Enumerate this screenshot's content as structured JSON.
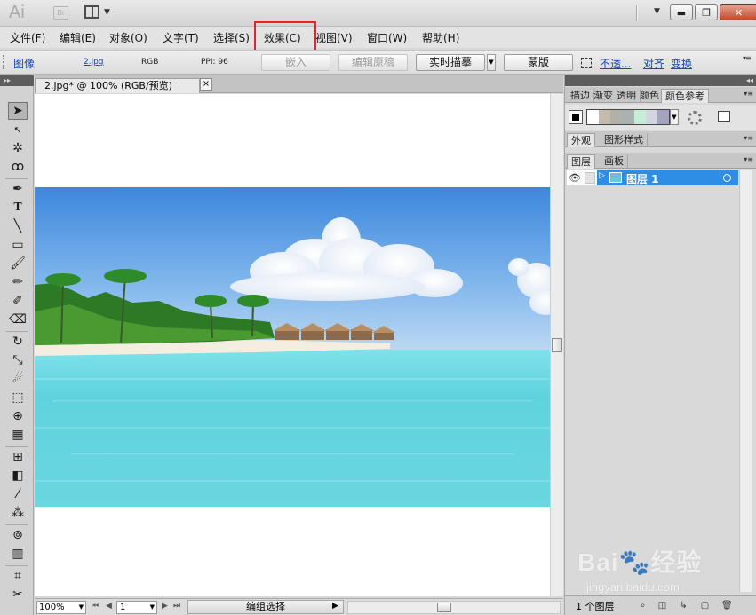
{
  "app": {
    "logo": "Ai",
    "bridge": "Br"
  },
  "menubar": {
    "items": [
      "文件(F)",
      "编辑(E)",
      "对象(O)",
      "文字(T)",
      "选择(S)",
      "效果(C)",
      "视图(V)",
      "窗口(W)",
      "帮助(H)"
    ],
    "highlighted": "效果(C)",
    "highlight_color": "#e0242a"
  },
  "control_bar": {
    "type_label": "图像",
    "filename": "2.jpg",
    "color_mode": "RGB",
    "ppi": "PPI: 96",
    "embed_label": "嵌入",
    "edit_original_label": "编辑原稿",
    "live_trace_label": "实时描摹",
    "mask_label": "蒙版",
    "opacity_label": "不透...",
    "align_label": "对齐",
    "transform_label": "变换"
  },
  "document": {
    "tab_title": "2.jpg* @ 100% (RGB/预览)",
    "close_icon": "×"
  },
  "statusbar": {
    "zoom": "100%",
    "page": "1",
    "status_text": "编组选择"
  },
  "right_panel": {
    "top_tabs": [
      "描边",
      "渐变",
      "透明",
      "颜色",
      "颜色参考"
    ],
    "appearance_tabs": [
      "外观",
      "图形样式"
    ],
    "layer_tabs": [
      "图层",
      "画板"
    ],
    "layer_name": "图层 1",
    "layer_count": "1 个图层",
    "accent": "#2e8ee6"
  },
  "color_guide_swatches": [
    "#ffffff",
    "#c6bcae",
    "#b3b0a8",
    "#a9b2ae",
    "#c7ecd7",
    "#d5d5e1",
    "#a5a4be"
  ],
  "watermark": {
    "text": "Bai🐾经验",
    "url": "jingyan.baidu.com"
  }
}
